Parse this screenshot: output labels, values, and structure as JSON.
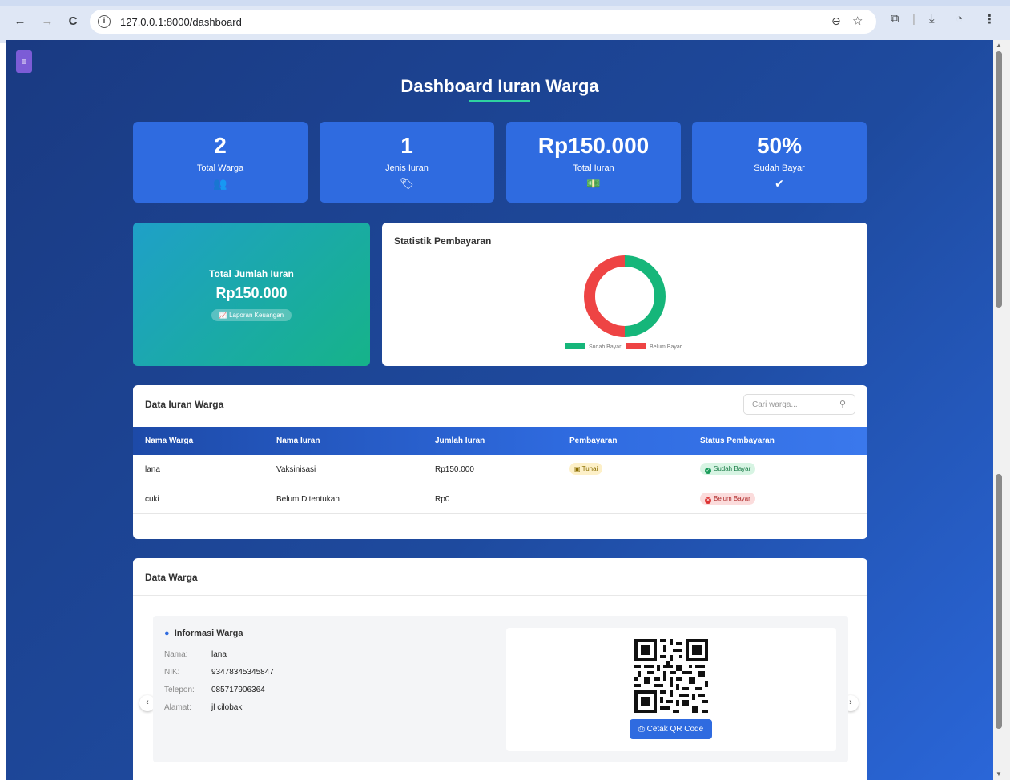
{
  "browser": {
    "url": "127.0.0.1:8000/dashboard",
    "back_icon": "←",
    "forward_icon": "→",
    "reload_icon": "C",
    "info_icon": "i",
    "zoom_icon": "⊖",
    "star_icon": "☆",
    "extensions_icon": "⧉",
    "download_icon": "⤓",
    "profile_icon": "◔",
    "menu_icon": "⋮"
  },
  "page": {
    "menu_icon": "≡",
    "title": "Dashboard Iuran Warga"
  },
  "stats": [
    {
      "value": "2",
      "label": "Total Warga",
      "icon": "👥"
    },
    {
      "value": "1",
      "label": "Jenis Iuran",
      "icon": "🏷"
    },
    {
      "value": "Rp150.000",
      "label": "Total Iuran",
      "icon": "💵"
    },
    {
      "value": "50%",
      "label": "Sudah Bayar",
      "icon": "✔"
    }
  ],
  "total_card": {
    "title": "Total Jumlah Iuran",
    "amount": "Rp150.000",
    "button_icon": "📈",
    "button_label": "Laporan Keuangan"
  },
  "chart_card": {
    "title": "Statistik Pembayaran"
  },
  "chart_data": {
    "type": "pie",
    "categories": [
      "Sudah Bayar",
      "Belum Bayar"
    ],
    "values": [
      1,
      1
    ],
    "colors": [
      "#16b67a",
      "#ee4444"
    ],
    "legend": "bottom",
    "title": ""
  },
  "iuran_table": {
    "title": "Data Iuran Warga",
    "search_placeholder": "Cari warga...",
    "search_icon": "⚲",
    "columns": [
      "Nama Warga",
      "Nama Iuran",
      "Jumlah Iuran",
      "Pembayaran",
      "Status Pembayaran"
    ],
    "rows": [
      {
        "nama": "lana",
        "iuran": "Vaksinisasi",
        "jumlah": "Rp150.000",
        "pembayaran": "Tunai",
        "status": "Sudah Bayar"
      },
      {
        "nama": "cuki",
        "iuran": "Belum Ditentukan",
        "jumlah": "Rp0",
        "pembayaran": "",
        "status": "Belum Bayar"
      }
    ]
  },
  "warga_card": {
    "title": "Data Warga",
    "info_title": "Informasi Warga",
    "info_icon": "●",
    "fields": [
      {
        "label": "Nama:",
        "value": "lana"
      },
      {
        "label": "NIK:",
        "value": "93478345345847"
      },
      {
        "label": "Telepon:",
        "value": "085717906364"
      },
      {
        "label": "Alamat:",
        "value": "jl cilobak"
      }
    ],
    "qr_button_icon": "⎙",
    "qr_button_label": "Cetak QR Code",
    "prev_icon": "‹",
    "next_icon": "›"
  },
  "colors": {
    "primary": "#2f6be0",
    "success": "#16b67a",
    "danger": "#ee4444",
    "accent_underline": "#2ed3a0"
  }
}
